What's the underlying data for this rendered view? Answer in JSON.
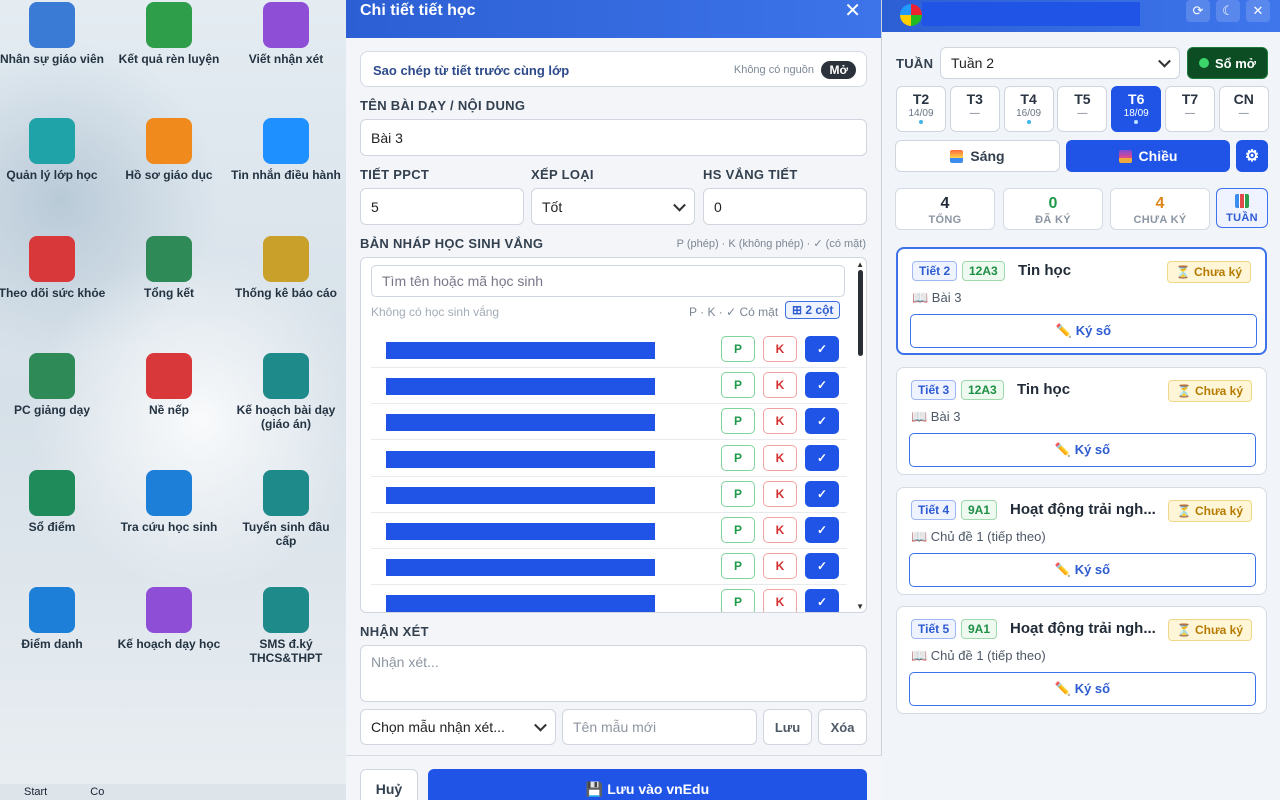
{
  "desktop": {
    "icons": [
      {
        "label": "Nhân sự giáo viên",
        "icon": "id-card-icon",
        "color": "#3a7bd5"
      },
      {
        "label": "Kết quả rèn luyện",
        "icon": "chart-growth-icon",
        "color": "#2e9e4a"
      },
      {
        "label": "Viết nhận xét",
        "icon": "list-doc-icon",
        "color": "#8e4fd6"
      },
      {
        "label": "Quản lý lớp học",
        "icon": "group-icon",
        "color": "#1fa3a8"
      },
      {
        "label": "Hồ sơ giáo dục",
        "icon": "folder-doc-icon",
        "color": "#f08a1c"
      },
      {
        "label": "Tin nhắn điều hành",
        "icon": "chat-icon",
        "color": "#1e90ff"
      },
      {
        "label": "Theo dõi sức khỏe",
        "icon": "medical-kit-icon",
        "color": "#d9383a"
      },
      {
        "label": "Tổng kết",
        "icon": "sum-icon",
        "color": "#2e8b57"
      },
      {
        "label": "Thống kê báo cáo",
        "icon": "clipboard-chart-icon",
        "color": "#c9a02a"
      },
      {
        "label": "PC giảng dạy",
        "icon": "chalkboard-icon",
        "color": "#2e8b57"
      },
      {
        "label": "Nề nếp",
        "icon": "warning-doc-icon",
        "color": "#d9383a"
      },
      {
        "label": "Kế hoạch bài dạy (giáo án)",
        "icon": "book-icon",
        "color": "#1f8a8a"
      },
      {
        "label": "Sổ điểm",
        "icon": "grade-book-icon",
        "color": "#1f8a5a"
      },
      {
        "label": "Tra cứu học sinh",
        "icon": "search-calc-icon",
        "color": "#1e7fd8"
      },
      {
        "label": "Tuyển sinh đầu cấp",
        "icon": "enroll-doc-icon",
        "color": "#1f8a8a"
      },
      {
        "label": "Điểm danh",
        "icon": "checklist-icon",
        "color": "#1e7fd8"
      },
      {
        "label": "Kế hoạch dạy học",
        "icon": "calendar-icon",
        "color": "#8e4fd6"
      },
      {
        "label": "SMS đ.ký THCS&THPT",
        "icon": "sms-icon",
        "color": "#1f8a8a"
      }
    ],
    "taskbar": {
      "start": "Start",
      "item": "Co"
    }
  },
  "modal": {
    "title": "Chi tiết tiết học",
    "copy": {
      "label": "Sao chép từ tiết trước cùng lớp",
      "status": "Không có nguồn",
      "open": "Mở"
    },
    "lesson_label": "TÊN BÀI DẠY / NỘI DUNG",
    "lesson_value": "Bài 3",
    "ppct_label": "TIẾT PPCT",
    "ppct_value": "5",
    "rank_label": "XẾP LOẠI",
    "rank_value": "Tốt",
    "absent_label": "HS VẮNG TIẾT",
    "absent_value": "0",
    "draft_label": "BẢN NHÁP HỌC SINH VẮNG",
    "draft_hint": "P (phép) · K (không phép) · ✓ (có mặt)",
    "search_placeholder": "Tìm tên hoặc mã học sinh",
    "no_absent": "Không có học sinh vắng",
    "legend": "P · K · ✓ Có mặt",
    "two_col": "⊞ 2 cột",
    "btn_p": "P",
    "btn_k": "K",
    "btn_check": "✓",
    "comment_label": "NHẬN XÉT",
    "comment_placeholder": "Nhận xét...",
    "template_select": "Chọn mẫu nhận xét...",
    "template_name_placeholder": "Tên mẫu mới",
    "save_template": "Lưu",
    "delete_template": "Xóa",
    "cancel": "Huỷ",
    "save_vnedu": "💾 Lưu vào vnEdu"
  },
  "panel": {
    "week_label": "TUẦN",
    "week_value": "Tuần 2",
    "open_book": "Sổ mở",
    "days": [
      {
        "d": "T2",
        "dt": "14/09",
        "dot": true
      },
      {
        "d": "T3",
        "dt": "—",
        "dot": false
      },
      {
        "d": "T4",
        "dt": "16/09",
        "dot": true
      },
      {
        "d": "T5",
        "dt": "—",
        "dot": false
      },
      {
        "d": "T6",
        "dt": "18/09",
        "dot": true,
        "active": true
      },
      {
        "d": "T7",
        "dt": "—",
        "dot": false
      },
      {
        "d": "CN",
        "dt": "—",
        "dot": false
      }
    ],
    "morning": "Sáng",
    "afternoon": "Chiều",
    "stats": {
      "total": "4",
      "total_label": "TỔNG",
      "signed": "0",
      "signed_label": "ĐÃ KÝ",
      "unsigned": "4",
      "unsigned_label": "CHƯA KÝ",
      "week_label": "TUẦN"
    },
    "cards": [
      {
        "period": "Tiết 2",
        "class": "12A3",
        "subject": "Tin học",
        "status": "⏳ Chưa ký",
        "lesson": "📖 Bài 3",
        "sign": "✏️ Ký số"
      },
      {
        "period": "Tiết 3",
        "class": "12A3",
        "subject": "Tin học",
        "status": "⏳ Chưa ký",
        "lesson": "📖 Bài 3",
        "sign": "✏️ Ký số"
      },
      {
        "period": "Tiết 4",
        "class": "9A1",
        "subject": "Hoạt động trải ngh...",
        "status": "⏳ Chưa ký",
        "lesson": "📖 Chủ đề 1 (tiếp theo)",
        "sign": "✏️ Ký số"
      },
      {
        "period": "Tiết 5",
        "class": "9A1",
        "subject": "Hoạt động trải ngh...",
        "status": "⏳ Chưa ký",
        "lesson": "📖 Chủ đề 1 (tiếp theo)",
        "sign": "✏️ Ký số"
      }
    ]
  }
}
